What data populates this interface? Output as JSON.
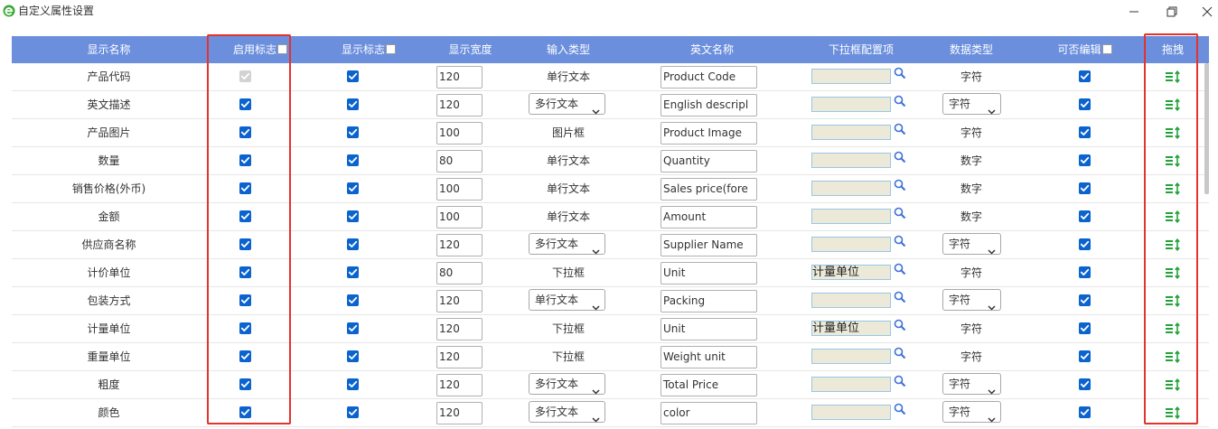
{
  "window": {
    "title": "自定义属性设置",
    "app_icon": "green-e-icon"
  },
  "columns": {
    "name": "显示名称",
    "enable": "启用标志",
    "display": "显示标志",
    "width": "显示宽度",
    "input_type": "输入类型",
    "english": "英文名称",
    "dropdown": "下拉框配置项",
    "data_type": "数据类型",
    "editable": "可否编辑",
    "drag": "拖拽"
  },
  "rows": [
    {
      "name": "产品代码",
      "enable": true,
      "enable_disabled": true,
      "display": true,
      "width": "120",
      "input_type": "单行文本",
      "input_type_select": false,
      "english": "Product Code",
      "dropdown": "",
      "data_type": "字符",
      "data_type_select": false,
      "editable": true
    },
    {
      "name": "英文描述",
      "enable": true,
      "enable_disabled": false,
      "display": true,
      "width": "120",
      "input_type": "多行文本",
      "input_type_select": true,
      "english": "English descripl",
      "dropdown": "",
      "data_type": "字符",
      "data_type_select": true,
      "editable": true
    },
    {
      "name": "产品图片",
      "enable": true,
      "enable_disabled": false,
      "display": true,
      "width": "100",
      "input_type": "图片框",
      "input_type_select": false,
      "english": "Product Image",
      "dropdown": "",
      "data_type": "字符",
      "data_type_select": false,
      "editable": true
    },
    {
      "name": "数量",
      "enable": true,
      "enable_disabled": false,
      "display": true,
      "width": "80",
      "input_type": "单行文本",
      "input_type_select": false,
      "english": "Quantity",
      "dropdown": "",
      "data_type": "数字",
      "data_type_select": false,
      "editable": true
    },
    {
      "name": "销售价格(外币)",
      "enable": true,
      "enable_disabled": false,
      "display": true,
      "width": "100",
      "input_type": "单行文本",
      "input_type_select": false,
      "english": "Sales price(fore",
      "dropdown": "",
      "data_type": "数字",
      "data_type_select": false,
      "editable": true
    },
    {
      "name": "金额",
      "enable": true,
      "enable_disabled": false,
      "display": true,
      "width": "100",
      "input_type": "单行文本",
      "input_type_select": false,
      "english": "Amount",
      "dropdown": "",
      "data_type": "数字",
      "data_type_select": false,
      "editable": true
    },
    {
      "name": "供应商名称",
      "enable": true,
      "enable_disabled": false,
      "display": true,
      "width": "120",
      "input_type": "多行文本",
      "input_type_select": true,
      "english": "Supplier Name",
      "dropdown": "",
      "data_type": "字符",
      "data_type_select": true,
      "editable": true
    },
    {
      "name": "计价单位",
      "enable": true,
      "enable_disabled": false,
      "display": true,
      "width": "80",
      "input_type": "下拉框",
      "input_type_select": false,
      "english": "Unit",
      "dropdown": "计量单位",
      "data_type": "字符",
      "data_type_select": false,
      "editable": true
    },
    {
      "name": "包装方式",
      "enable": true,
      "enable_disabled": false,
      "display": true,
      "width": "120",
      "input_type": "单行文本",
      "input_type_select": true,
      "english": "Packing",
      "dropdown": "",
      "data_type": "字符",
      "data_type_select": true,
      "editable": true
    },
    {
      "name": "计量单位",
      "enable": true,
      "enable_disabled": false,
      "display": true,
      "width": "120",
      "input_type": "下拉框",
      "input_type_select": false,
      "english": "Unit",
      "dropdown": "计量单位",
      "data_type": "字符",
      "data_type_select": false,
      "editable": true
    },
    {
      "name": "重量单位",
      "enable": true,
      "enable_disabled": false,
      "display": true,
      "width": "120",
      "input_type": "下拉框",
      "input_type_select": false,
      "english": "Weight unit",
      "dropdown": "",
      "data_type": "字符",
      "data_type_select": false,
      "editable": true
    },
    {
      "name": "粗度",
      "enable": true,
      "enable_disabled": false,
      "display": true,
      "width": "120",
      "input_type": "多行文本",
      "input_type_select": true,
      "english": "Total Price",
      "dropdown": "",
      "data_type": "字符",
      "data_type_select": true,
      "editable": true
    },
    {
      "name": "颜色",
      "enable": true,
      "enable_disabled": false,
      "display": true,
      "width": "120",
      "input_type": "多行文本",
      "input_type_select": true,
      "english": "color",
      "dropdown": "",
      "data_type": "字符",
      "data_type_select": true,
      "editable": true
    }
  ],
  "colors": {
    "header_bg": "#6b8fdd",
    "checkbox": "#0b63ce",
    "highlight": "#e5322d",
    "drag_icon": "#22a33a",
    "dropdown_bg": "#ece9d8"
  }
}
